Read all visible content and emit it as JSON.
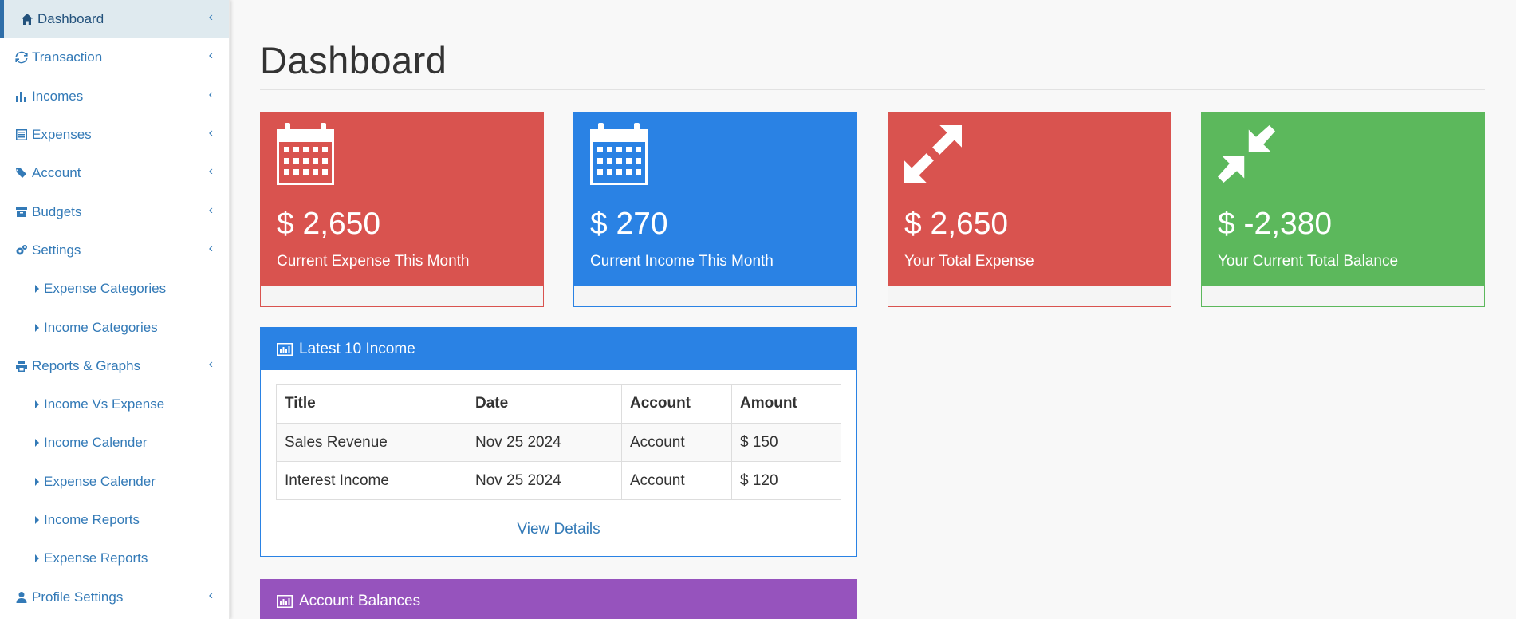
{
  "sidebar": {
    "items": [
      {
        "label": "Dashboard",
        "icon": "home-icon"
      },
      {
        "label": "Transaction",
        "icon": "refresh-icon"
      },
      {
        "label": "Incomes",
        "icon": "bar-chart-icon"
      },
      {
        "label": "Expenses",
        "icon": "list-alt-icon"
      },
      {
        "label": "Account",
        "icon": "tags-icon"
      },
      {
        "label": "Budgets",
        "icon": "archive-icon"
      },
      {
        "label": "Settings",
        "icon": "gears-icon"
      },
      {
        "label": "Expense Categories"
      },
      {
        "label": "Income Categories"
      },
      {
        "label": "Reports & Graphs",
        "icon": "print-icon"
      },
      {
        "label": "Income Vs Expense"
      },
      {
        "label": "Income Calender"
      },
      {
        "label": "Expense Calender"
      },
      {
        "label": "Income Reports"
      },
      {
        "label": "Expense Reports"
      },
      {
        "label": "Profile Settings",
        "icon": "user-icon"
      }
    ],
    "chevron": "‹"
  },
  "page": {
    "title": "Dashboard"
  },
  "cards": [
    {
      "value": "$ 2,650",
      "label": "Current Expense This Month",
      "color": "#d9534f",
      "icon": "calendar-icon"
    },
    {
      "value": "$ 270",
      "label": "Current Income This Month",
      "color": "#2a82e4",
      "icon": "calendar-icon"
    },
    {
      "value": "$ 2,650",
      "label": "Your Total Expense",
      "color": "#d9534f",
      "icon": "expand-arrows-icon"
    },
    {
      "value": "$ -2,380",
      "label": "Your Current Total Balance",
      "color": "#5cb85c",
      "icon": "compress-arrows-icon"
    }
  ],
  "latest_income": {
    "title": "Latest 10 Income",
    "columns": [
      "Title",
      "Date",
      "Account",
      "Amount"
    ],
    "rows": [
      [
        "Sales Revenue",
        "Nov 25 2024",
        "Account",
        "$ 150"
      ],
      [
        "Interest Income",
        "Nov 25 2024",
        "Account",
        "$ 120"
      ]
    ],
    "view_details": "View Details"
  },
  "account_balances": {
    "title": "Account Balances"
  }
}
